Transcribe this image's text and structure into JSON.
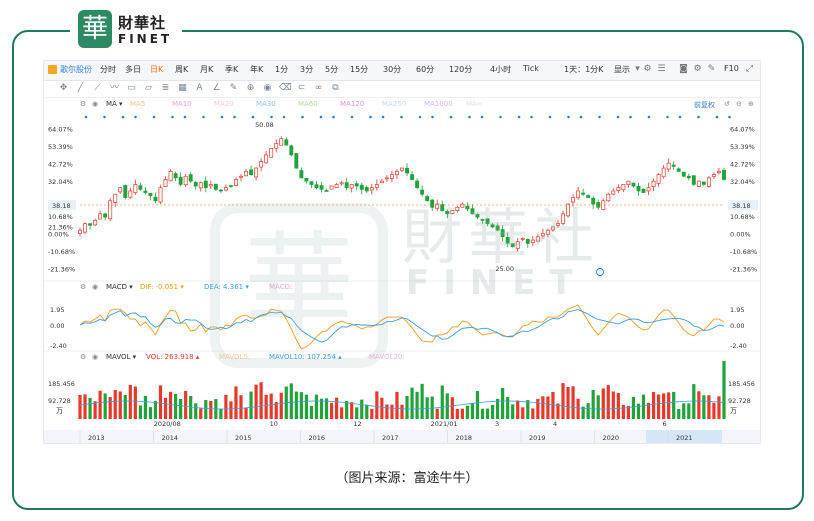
{
  "brand": {
    "mark": "華",
    "name_cn": "財華社",
    "name_en": "FINET"
  },
  "watermark": {
    "cn": "財華社",
    "en": "FINET",
    "mark": "華"
  },
  "toolbar": {
    "stock": "歌尔股份",
    "periods": [
      "分时",
      "多日",
      "日K",
      "周K",
      "月K",
      "季K",
      "年K",
      "1分",
      "3分",
      "5分",
      "15分",
      "30分",
      "60分",
      "120分",
      "4小时",
      "Tick",
      "1天：1分K"
    ],
    "active_period": "日K",
    "right": [
      "显示",
      "F10"
    ]
  },
  "main_indicator": {
    "name": "MA",
    "items": [
      "MA5",
      "MA10",
      "MA20",
      "MA30",
      "MA60",
      "MA120",
      "MA250",
      "MA1000",
      "MA∞"
    ],
    "right_label": "前复权"
  },
  "macd_legend": {
    "name": "MACD",
    "dif": "DIF: -0.051",
    "dea": "DEA: 4.361",
    "macd": "MACD:"
  },
  "vol_legend": {
    "name": "MAVOL",
    "vol": "VOL: 263.918",
    "mavol5": "MAVOL5:",
    "mavol10": "MAVOL10: 107.254",
    "mavol20": "MAVOL20:"
  },
  "caption": "（图片来源：富途牛牛）",
  "colors": {
    "up": "#e8382b",
    "down": "#1fa33a",
    "dif": "#f59a23",
    "dea": "#3a9ee0",
    "accent": "#ff6a00"
  },
  "chart_data": {
    "type": "candlestick",
    "price_axis": {
      "ticks": [
        "64.07%",
        "53.39%",
        "42.72%",
        "32.04%",
        "21.36%",
        "10.68%",
        "0.00%",
        "-10.68%",
        "-21.36%"
      ],
      "ylim": [
        -26,
        70
      ]
    },
    "last_price_label": "38.18",
    "annotations": [
      {
        "text": "50.08",
        "x": 0.272
      },
      {
        "text": "25.00",
        "x": 0.645
      }
    ],
    "macd_axis": {
      "ticks": [
        "1.95",
        "0.00",
        "-2.40"
      ]
    },
    "volume_axis": {
      "ticks": [
        "185.456",
        "92.728"
      ],
      "unit": "万"
    },
    "date_labels_top": [
      "2020/08",
      "10",
      "12",
      "2021/01",
      "3",
      "4",
      "6"
    ],
    "date_labels_top_x": [
      0.13,
      0.31,
      0.44,
      0.56,
      0.66,
      0.75,
      0.92
    ],
    "year_labels": [
      "2013",
      "2014",
      "2015",
      "2016",
      "2017",
      "2018",
      "2019",
      "2020",
      "2021"
    ],
    "close_series": [
      2,
      6,
      5,
      8,
      12,
      10,
      20,
      24,
      28,
      22,
      26,
      30,
      27,
      25,
      23,
      20,
      28,
      33,
      38,
      34,
      30,
      35,
      32,
      29,
      31,
      28,
      30,
      27,
      26,
      28,
      29,
      33,
      35,
      38,
      36,
      40,
      44,
      48,
      52,
      55,
      58,
      54,
      48,
      40,
      34,
      32,
      30,
      28,
      27,
      26,
      29,
      30,
      31,
      28,
      30,
      29,
      27,
      26,
      28,
      30,
      32,
      34,
      36,
      38,
      40,
      37,
      33,
      28,
      24,
      20,
      16,
      18,
      14,
      12,
      14,
      16,
      18,
      15,
      12,
      10,
      8,
      6,
      4,
      2,
      -2,
      -6,
      -8,
      -5,
      -3,
      -6,
      -4,
      -2,
      0,
      2,
      4,
      6,
      12,
      18,
      22,
      26,
      24,
      22,
      18,
      16,
      20,
      24,
      26,
      28,
      30,
      32,
      29,
      26,
      25,
      28,
      32,
      36,
      40,
      43,
      41,
      38,
      35,
      34,
      30,
      32,
      30,
      34,
      36,
      38,
      33
    ]
  }
}
